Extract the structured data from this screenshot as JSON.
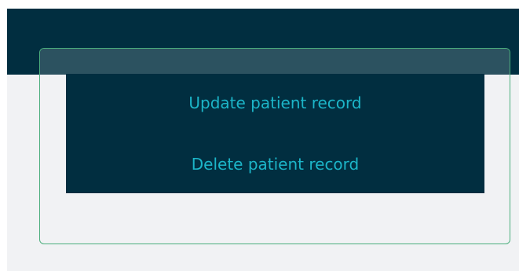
{
  "menu": {
    "items": [
      {
        "label": "Update patient record"
      },
      {
        "label": "Delete patient record"
      }
    ]
  },
  "colors": {
    "top_bar": "#012e40",
    "content_background": "#f1f2f4",
    "frame_border": "#4caf7d",
    "frame_header": "#2c5260",
    "menu_background": "#012e40",
    "menu_text": "#1cb5c8"
  }
}
